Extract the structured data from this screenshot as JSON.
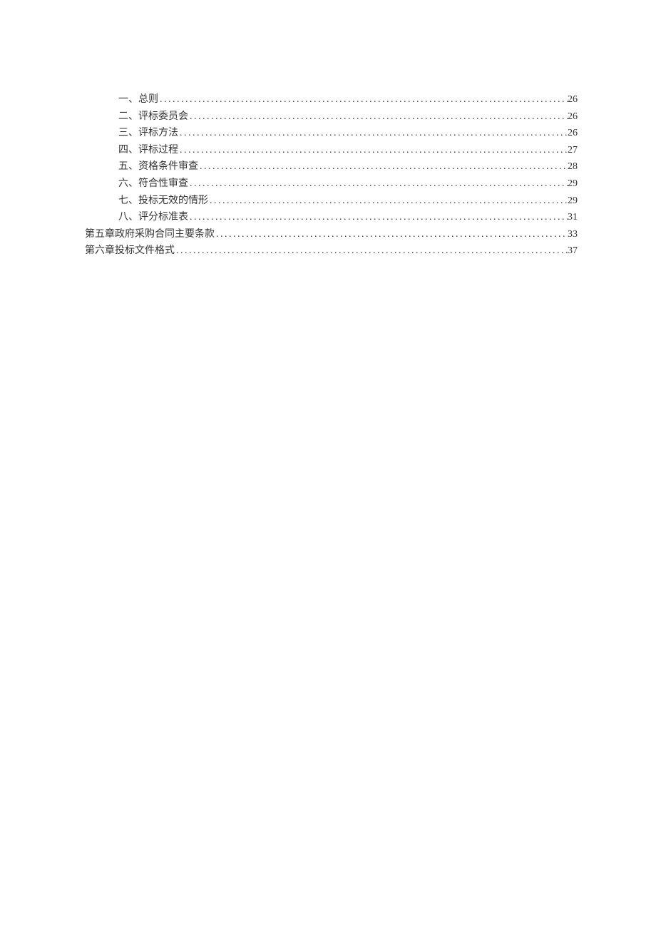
{
  "toc": {
    "dots": "....................................................................................................................................................................................................",
    "entries": [
      {
        "level": 2,
        "label": "一、总则",
        "page": "26"
      },
      {
        "level": 2,
        "label": "二、评标委员会",
        "page": "26"
      },
      {
        "level": 2,
        "label": "三、评标方法",
        "page": "26"
      },
      {
        "level": 2,
        "label": "四、评标过程",
        "page": "27"
      },
      {
        "level": 2,
        "label": "五、资格条件审查",
        "page": "28"
      },
      {
        "level": 2,
        "label": "六、符合性审查",
        "page": "29"
      },
      {
        "level": 2,
        "label": "七、投标无效的情形",
        "page": "29"
      },
      {
        "level": 2,
        "label": "八、评分标准表",
        "page": "31"
      },
      {
        "level": 1,
        "label": "第五章政府采购合同主要条款",
        "page": "33"
      },
      {
        "level": 1,
        "label": "第六章投标文件格式",
        "page": "37"
      }
    ]
  }
}
